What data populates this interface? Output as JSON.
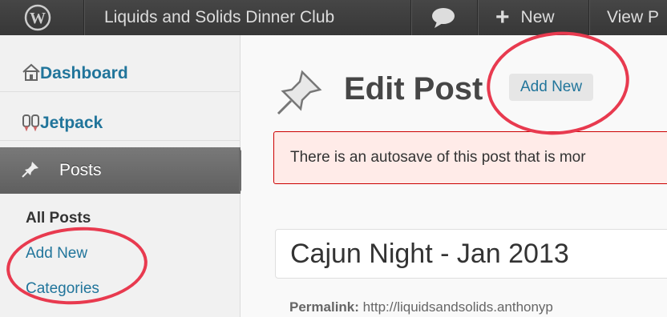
{
  "admin_bar": {
    "site_name": "Liquids and Solids Dinner Club",
    "new_label": "New",
    "view_label": "View P",
    "icons": {
      "logo": "wordpress-icon",
      "comments": "comment-icon",
      "new": "plus-icon"
    }
  },
  "sidebar": {
    "dashboard_label": "Dashboard",
    "jetpack_label": "Jetpack",
    "posts_label": "Posts",
    "submenu": {
      "all_posts": "All Posts",
      "add_new": "Add New",
      "categories": "Categories"
    }
  },
  "main": {
    "page_title": "Edit Post",
    "add_new_button": "Add New",
    "notice_text": "There is an autosave of this post that is mor",
    "post_title_value": "Cajun Night - Jan 2013",
    "permalink_label": "Permalink:",
    "permalink_url": "http://liquidsandsolids.anthonyp"
  },
  "colors": {
    "admin_bar_bg": "#3a3a3a",
    "link_blue": "#21759b",
    "notice_bg": "#ffebe8",
    "notice_border": "#cc0000",
    "annotation_red": "#e83a4f"
  }
}
